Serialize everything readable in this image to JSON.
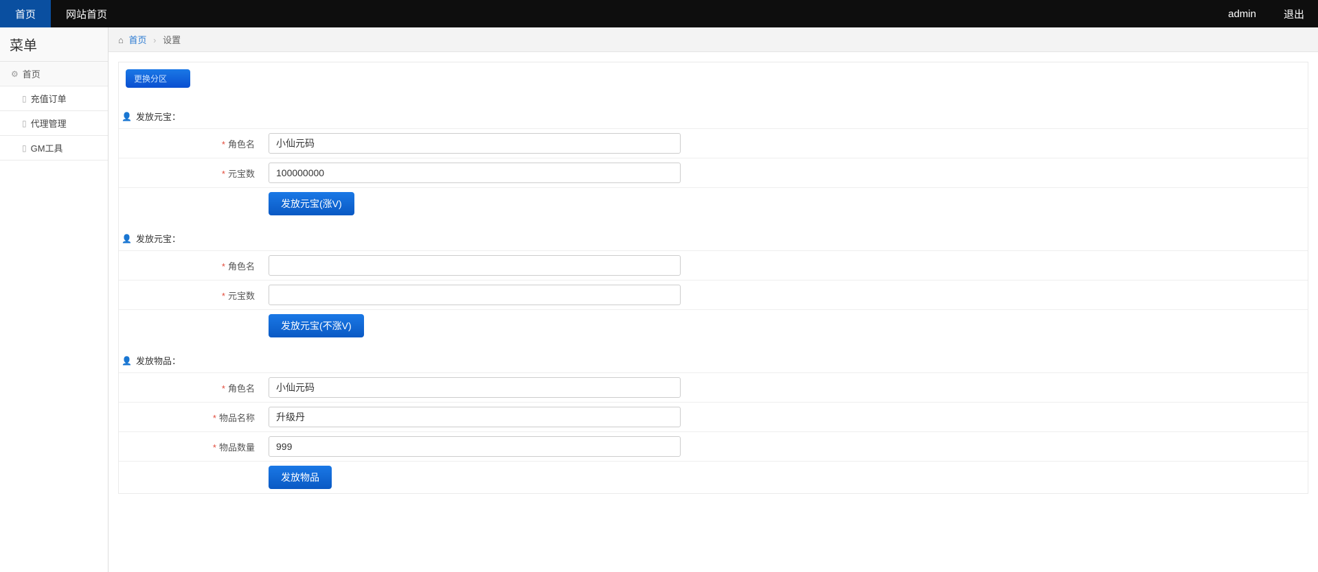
{
  "topnav": {
    "home": "首页",
    "site_home": "网站首页",
    "user": "admin",
    "logout": "退出"
  },
  "sidebar": {
    "title": "菜单",
    "group_home": "首页",
    "items": [
      {
        "label": "充值订单"
      },
      {
        "label": "代理管理"
      },
      {
        "label": "GM工具"
      }
    ]
  },
  "breadcrumb": {
    "home": "首页",
    "current": "设置"
  },
  "panel": {
    "switch_zone": "更换分区",
    "sections": {
      "yuanbao_v": {
        "title": "发放元宝：",
        "fields": {
          "role_label": "角色名",
          "role_value": "小仙元码",
          "amount_label": "元宝数",
          "amount_value": "100000000"
        },
        "button": "发放元宝(涨V)"
      },
      "yuanbao_nv": {
        "title": "发放元宝：",
        "fields": {
          "role_label": "角色名",
          "role_value": "",
          "amount_label": "元宝数",
          "amount_value": ""
        },
        "button": "发放元宝(不涨V)"
      },
      "item": {
        "title": "发放物品：",
        "fields": {
          "role_label": "角色名",
          "role_value": "小仙元码",
          "item_name_label": "物品名称",
          "item_name_value": "升级丹",
          "item_qty_label": "物品数量",
          "item_qty_value": "999"
        },
        "button": "发放物品"
      }
    }
  }
}
